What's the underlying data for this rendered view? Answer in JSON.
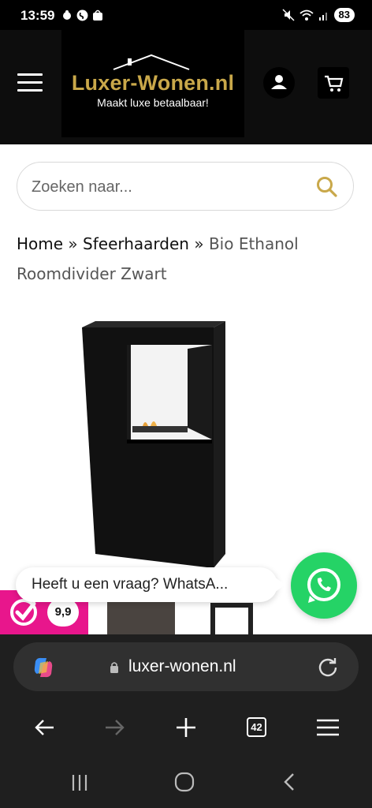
{
  "status_bar": {
    "time": "13:59",
    "battery": "83"
  },
  "header": {
    "logo_name": "Luxer-Wonen.nl",
    "logo_tagline": "Maakt luxe betaalbaar!"
  },
  "search": {
    "placeholder": "Zoeken naar..."
  },
  "breadcrumb": {
    "items": [
      "Home",
      "Sfeerhaarden"
    ],
    "separator": "»",
    "current": "Bio Ethanol Roomdivider Zwart"
  },
  "whatsapp": {
    "prompt": "Heeft u een vraag? WhatsA..."
  },
  "rating": {
    "score": "9,9"
  },
  "browser": {
    "url": "luxer-wonen.nl",
    "tab_count": "42"
  },
  "colors": {
    "brand_gold": "#c9a84a",
    "header_bg": "#0d0d0d",
    "whatsapp_green": "#25d366",
    "rating_pink": "#e8168c"
  }
}
